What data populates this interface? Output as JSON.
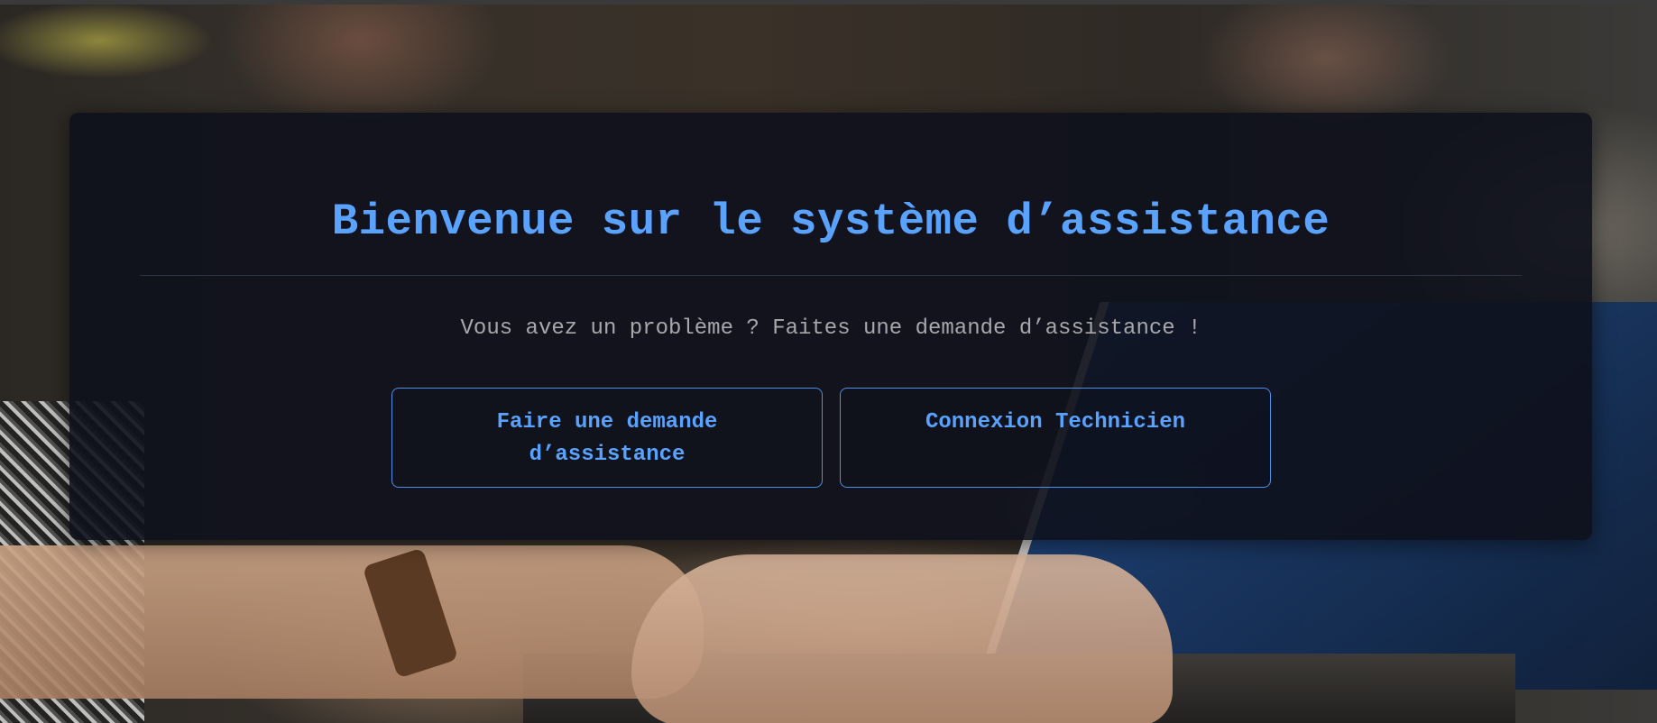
{
  "hero": {
    "title": "Bienvenue sur le système d’assistance",
    "subtitle": "Vous avez un problème ? Faites une demande d’assistance !"
  },
  "actions": {
    "request_label": "Faire une demande d’assistance",
    "technician_label": "Connexion Technicien"
  },
  "colors": {
    "accent": "#5aa2ff",
    "card_background": "#0e111c",
    "subtitle_text": "#a8a8ac"
  }
}
